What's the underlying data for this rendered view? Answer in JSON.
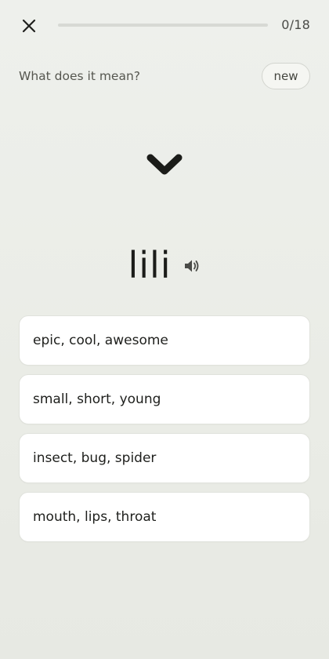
{
  "header": {
    "progress_text": "0/18",
    "progress_fraction": 0,
    "close_icon": "close-icon"
  },
  "prompt": {
    "question": "What does it mean?",
    "badge": "new"
  },
  "glyph": {
    "icon": "chevron-down-icon",
    "color": "#1b1c19"
  },
  "word": {
    "text": "lili",
    "audio_icon": "speaker-icon"
  },
  "options": [
    {
      "label": "epic, cool, awesome"
    },
    {
      "label": "small, short, young"
    },
    {
      "label": "insect, bug, spider"
    },
    {
      "label": "mouth, lips, throat"
    }
  ]
}
